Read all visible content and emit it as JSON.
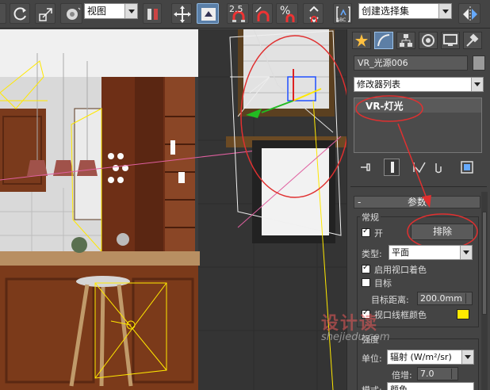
{
  "toolbar": {
    "viewport_select": "视图",
    "snap_angle_label": "2.5",
    "percent_label": "%",
    "named_selection_placeholder": "创建选择集",
    "abc_label": "ABC"
  },
  "panel": {
    "object_name": "VR_光源006",
    "modifier_list_label": "修改器列表",
    "stack_item": "VR-灯光",
    "parameters_header": "参数",
    "general_group_label": "常规",
    "on_label": "开",
    "on_checked": true,
    "exclude_button": "排除",
    "type_label": "类型:",
    "type_value": "平面",
    "enable_viewport_shading_label": "启用视口着色",
    "enable_viewport_shading_checked": true,
    "targeted_label": "目标",
    "targeted_checked": false,
    "target_distance_label": "目标距离:",
    "target_distance_value": "200.0mm",
    "viewport_wire_color_label": "视口线框颜色",
    "viewport_wire_color": "#ffea00",
    "intensity_group_label": "强度",
    "units_label": "单位:",
    "units_value": "辐射 (W/m²/sr)",
    "multiplier_label": "倍增:",
    "multiplier_value": "7.0",
    "mode_label": "模式:",
    "mode_value": "颜色"
  },
  "watermark": {
    "logo_text": "设计读",
    "url_text": "shejiedu.com"
  },
  "colors": {
    "annotation_red": "#e03030",
    "selection_yellow": "#ffe800",
    "active_tab": "#5d7fa6"
  }
}
